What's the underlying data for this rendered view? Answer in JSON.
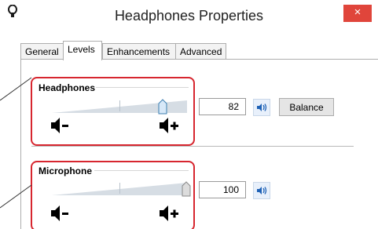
{
  "window": {
    "title": "Headphones Properties",
    "close_label": "×"
  },
  "tabs": [
    {
      "label": "General"
    },
    {
      "label": "Levels"
    },
    {
      "label": "Enhancements"
    },
    {
      "label": "Advanced"
    }
  ],
  "active_tab": "Levels",
  "headphones": {
    "label": "Headphones",
    "value": "82",
    "level_percent": 82,
    "balance_label": "Balance"
  },
  "microphone": {
    "label": "Microphone",
    "value": "100",
    "level_percent": 100
  },
  "icons": {
    "speaker_button": "speaker-icon",
    "volume_down": "volume-down-icon",
    "volume_up": "volume-up-icon"
  },
  "colors": {
    "close_button": "#e0453b",
    "callout_border": "#d7262f",
    "thumb_headphones": "#d7e8f8",
    "thumb_microphone": "#dcdcdc",
    "slider_fill": "#d6dde4"
  }
}
